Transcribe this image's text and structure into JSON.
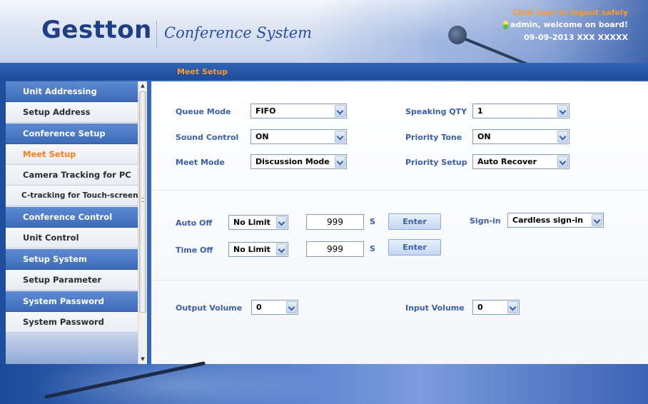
{
  "header": {
    "logo": "Gestton",
    "subtitle": "Conference System",
    "logout_text": "Click user to logout safely",
    "welcome_text": "admin, welcome on board!",
    "datetime": "09-09-2013 XXX XXXXX"
  },
  "titlebar": {
    "title": "Meet Setup"
  },
  "sidebar": {
    "items": [
      {
        "label": "Unit Addressing",
        "type": "group"
      },
      {
        "label": "Setup Address",
        "type": "sub"
      },
      {
        "label": "Conference Setup",
        "type": "group"
      },
      {
        "label": "Meet Setup",
        "type": "sub",
        "active": true
      },
      {
        "label": "Camera Tracking for PC",
        "type": "sub"
      },
      {
        "label": "C-tracking for Touch-screen",
        "type": "sub"
      },
      {
        "label": "Conference Control",
        "type": "group"
      },
      {
        "label": "Unit Control",
        "type": "sub"
      },
      {
        "label": "Setup System",
        "type": "group"
      },
      {
        "label": "Setup Parameter",
        "type": "sub"
      },
      {
        "label": "System Password",
        "type": "group"
      },
      {
        "label": "System Password",
        "type": "sub"
      }
    ]
  },
  "form": {
    "queue_mode": {
      "label": "Queue Mode",
      "value": "FIFO"
    },
    "speaking_qty": {
      "label": "Speaking QTY",
      "value": "1"
    },
    "sound_control": {
      "label": "Sound Control",
      "value": "ON"
    },
    "priority_tone": {
      "label": "Priority Tone",
      "value": "ON"
    },
    "meet_mode": {
      "label": "Meet Mode",
      "value": "Discussion Mode"
    },
    "priority_setup": {
      "label": "Priority Setup",
      "value": "Auto Recover"
    },
    "auto_off": {
      "label": "Auto Off",
      "select_value": "No Limit",
      "input_value": "999",
      "unit": "S",
      "button": "Enter"
    },
    "time_off": {
      "label": "Time Off",
      "select_value": "No Limit",
      "input_value": "999",
      "unit": "S",
      "button": "Enter"
    },
    "sign_in": {
      "label": "Sign-in",
      "value": "Cardless sign-in"
    },
    "output_volume": {
      "label": "Output Volume",
      "value": "0"
    },
    "input_volume": {
      "label": "Input Volume",
      "value": "0"
    }
  },
  "colors": {
    "accent_orange": "#ff9a2a",
    "label_blue": "#3a5ea8",
    "menu_group_blue": "#3d6bb9"
  }
}
